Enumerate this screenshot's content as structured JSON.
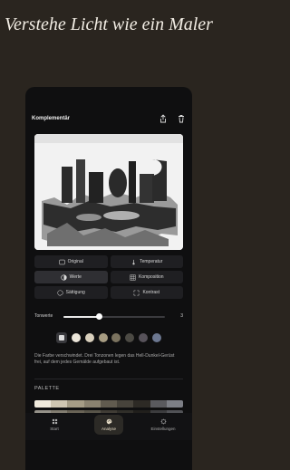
{
  "headline": "Verstehe Licht wie ein Maler",
  "screen": {
    "title": "Komplementär",
    "share_icon": "share-icon",
    "delete_icon": "trash-icon"
  },
  "buttons": [
    {
      "label": "Original",
      "icon": "image-icon"
    },
    {
      "label": "Temperatur",
      "icon": "thermometer-icon"
    },
    {
      "label": "Werte",
      "icon": "contrast-circle-icon",
      "active": true
    },
    {
      "label": "Komposition",
      "icon": "grid-icon"
    },
    {
      "label": "Sättigung",
      "icon": "palette-icon"
    },
    {
      "label": "Kontrast",
      "icon": "contrast-icon"
    }
  ],
  "slider": {
    "label": "Tonwerte",
    "value": "3",
    "level": 0.35
  },
  "swatches": {
    "colors": [
      "#ece6da",
      "#d9d0bd",
      "#a79c82",
      "#7b735f",
      "#4c4a44",
      "#57525a",
      "#6c7790"
    ]
  },
  "description": "Die Farbe verschwindet. Drei Tonzonen legen das Hell-Dunkel-Gerüst frei, auf dem jedes Gemälde aufgebaut ist.",
  "palette": {
    "label": "PALETTE",
    "colors": [
      "#efe9dc",
      "#cfc6b2",
      "#a59c86",
      "#8a8270",
      "#615b4f",
      "#47433b",
      "#2d2a25",
      "#5a5a5e",
      "#7d7f86"
    ]
  },
  "tabs": [
    {
      "label": "Start",
      "icon": "grid-icon"
    },
    {
      "label": "Analyse",
      "icon": "palette-icon",
      "active": true
    },
    {
      "label": "Einstellungen",
      "icon": "gear-icon"
    }
  ]
}
